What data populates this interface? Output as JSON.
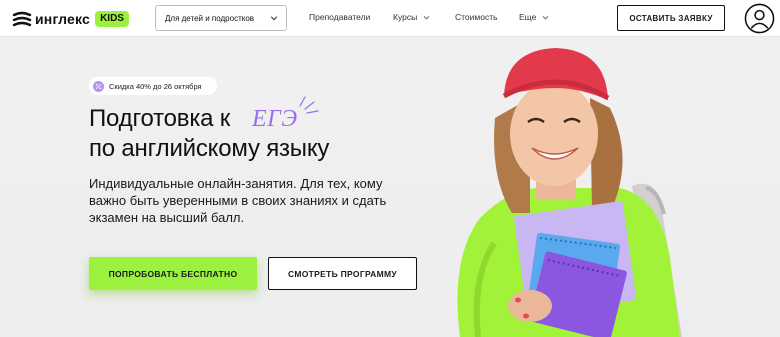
{
  "header": {
    "logo_text": "инглекс",
    "logo_badge": "KIDS",
    "age_select": "Для детей и подростков",
    "nav": [
      {
        "label": "Преподаватели"
      },
      {
        "label": "Курсы"
      },
      {
        "label": "Стоимость"
      },
      {
        "label": "Еще"
      }
    ],
    "cta_label": "ОСТАВИТЬ ЗАЯВКУ",
    "user_icon": "user-icon"
  },
  "hero": {
    "promo": "Скидка 40% до 26 октября",
    "title_line1": "Подготовка к",
    "title_accent": "ЕГЭ",
    "title_line2": "по английскому языку",
    "description": "Индивидуальные онлайн-занятия. Для тех, кому важно быть уверенными в своих знаниях и сдать экзамен на высший балл.",
    "primary_button": "ПОПРОБОВАТЬ БЕСПЛАТНО",
    "secondary_button": "СМОТРЕТЬ ПРОГРАММУ"
  },
  "colors": {
    "accent_green": "#9cf03e",
    "accent_purple": "#9b6ef0",
    "text_dark": "#111111",
    "background": "#efefef"
  }
}
